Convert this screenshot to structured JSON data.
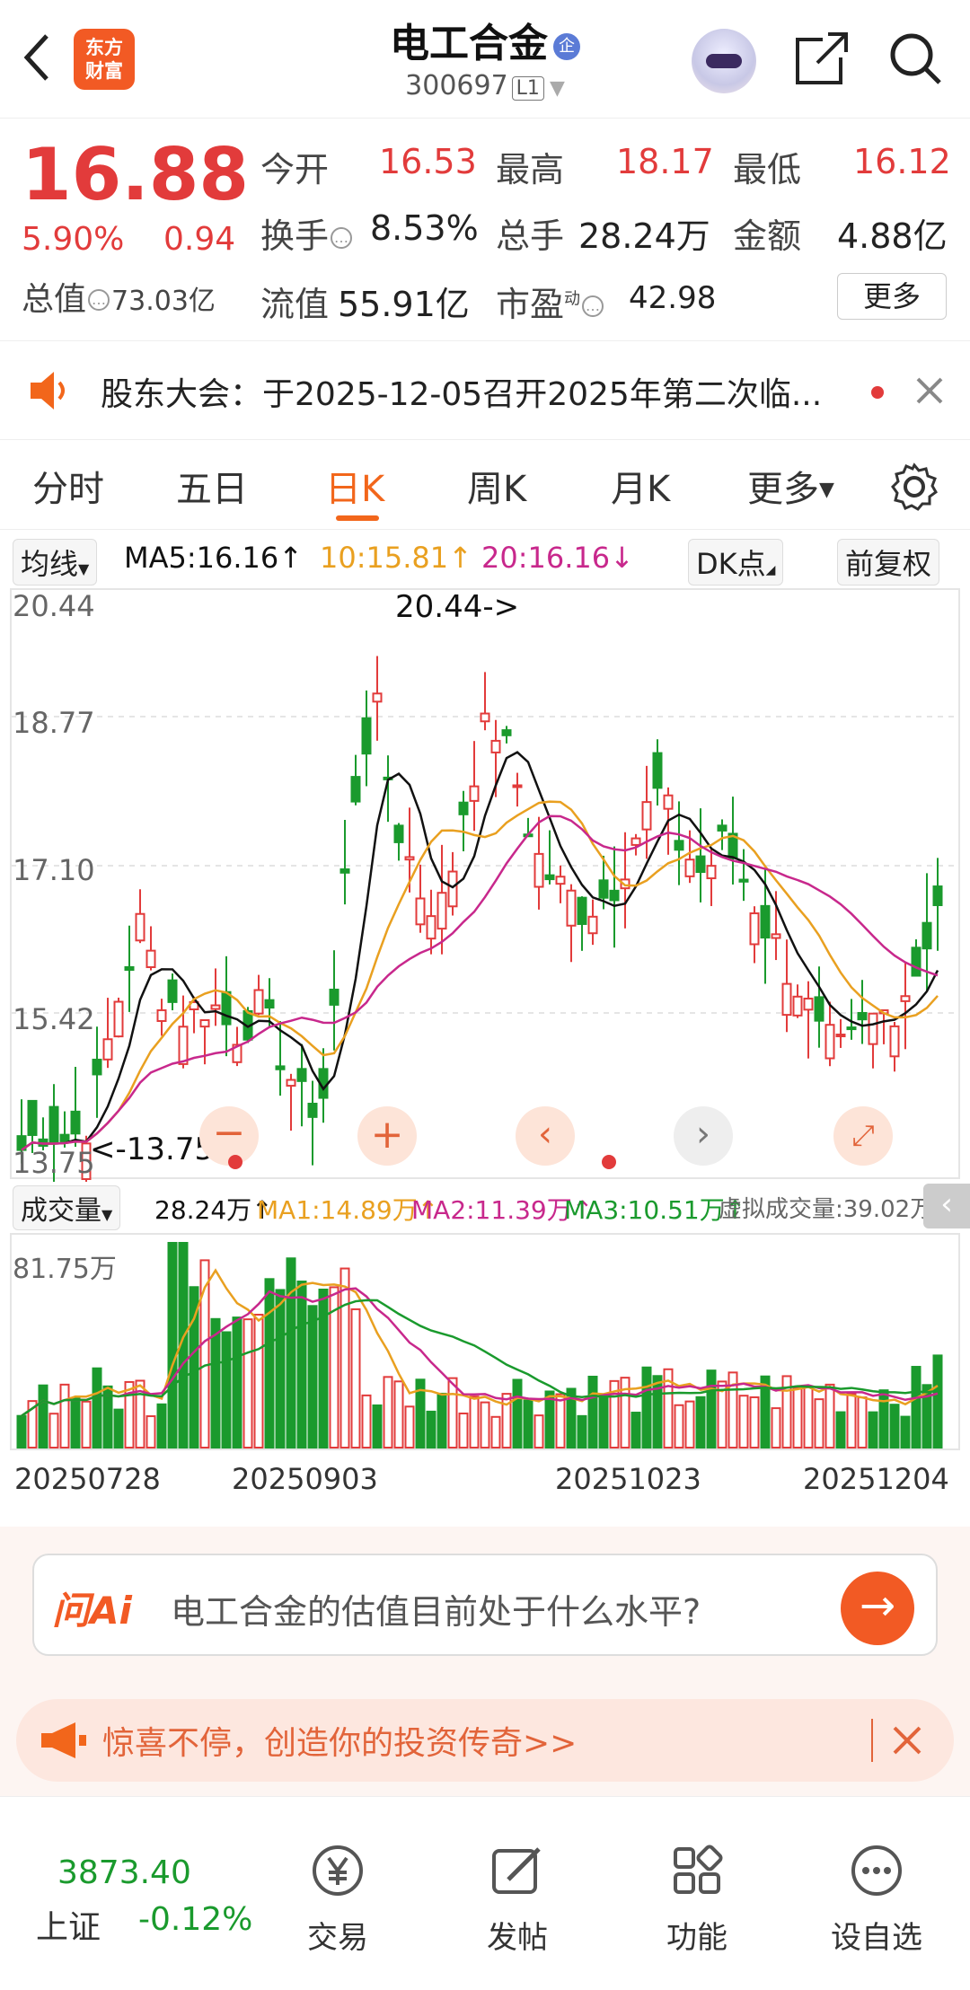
{
  "header": {
    "logo_text": "东方财富",
    "stock_name": "电工合金",
    "badge": "企",
    "code": "300697",
    "level": "L1"
  },
  "quote": {
    "price": "16.88",
    "change_pct": "5.90%",
    "change": "0.94",
    "open_label": "今开",
    "open": "16.53",
    "high_label": "最高",
    "high": "18.17",
    "low_label": "最低",
    "low": "16.12",
    "turnover_label": "换手",
    "turnover": "8.53%",
    "volume_label": "总手",
    "volume": "28.24万",
    "amount_label": "金额",
    "amount": "4.88亿",
    "mktcap_label": "总值",
    "mktcap": "73.03亿",
    "float_label": "流值",
    "float": "55.91亿",
    "pe_label": "市盈",
    "pe_sup": "动",
    "pe": "42.98",
    "more": "更多"
  },
  "notice": {
    "text": "股东大会：于2025-12-05召开2025年第二次临..."
  },
  "tabs": [
    "分时",
    "五日",
    "日K",
    "周K",
    "月K",
    "更多"
  ],
  "active_tab": "日K",
  "ma": {
    "select": "均线",
    "ma5": "MA5:16.16↑",
    "ma10": "10:15.81↑",
    "ma20": "20:16.16↓",
    "dk": "DK点",
    "adjust": "前复权"
  },
  "vol": {
    "select": "成交量",
    "value": "28.24万↑",
    "ma1": "MA1:14.89万↑",
    "ma2": "MA2:11.39万↑",
    "ma3": "MA3:10.51万↑",
    "virtual": "虚拟成交量:39.02万",
    "max_label": "81.75万"
  },
  "chart_labels": {
    "y_ticks": [
      "20.44",
      "18.77",
      "17.10",
      "15.42",
      "13.75"
    ],
    "high_mark": "20.44->",
    "low_mark": "<-13.75"
  },
  "dates": [
    "20250728",
    "20250903",
    "20251023",
    "20251204"
  ],
  "ai": {
    "logo": "问Ai",
    "question": "电工合金的估值目前处于什么水平?"
  },
  "banner": {
    "text": "惊喜不停，创造你的投资传奇>>"
  },
  "bottom": {
    "index_value": "3873.40",
    "index_name": "上证",
    "index_change": "-0.12%",
    "items": [
      "交易",
      "发帖",
      "功能",
      "设自选"
    ]
  },
  "colors": {
    "up": "#e23b3b",
    "down": "#1a9a2d",
    "accent": "#f2661b",
    "ma5": "#111111",
    "ma10": "#e9a020",
    "ma20": "#c8288c"
  }
}
